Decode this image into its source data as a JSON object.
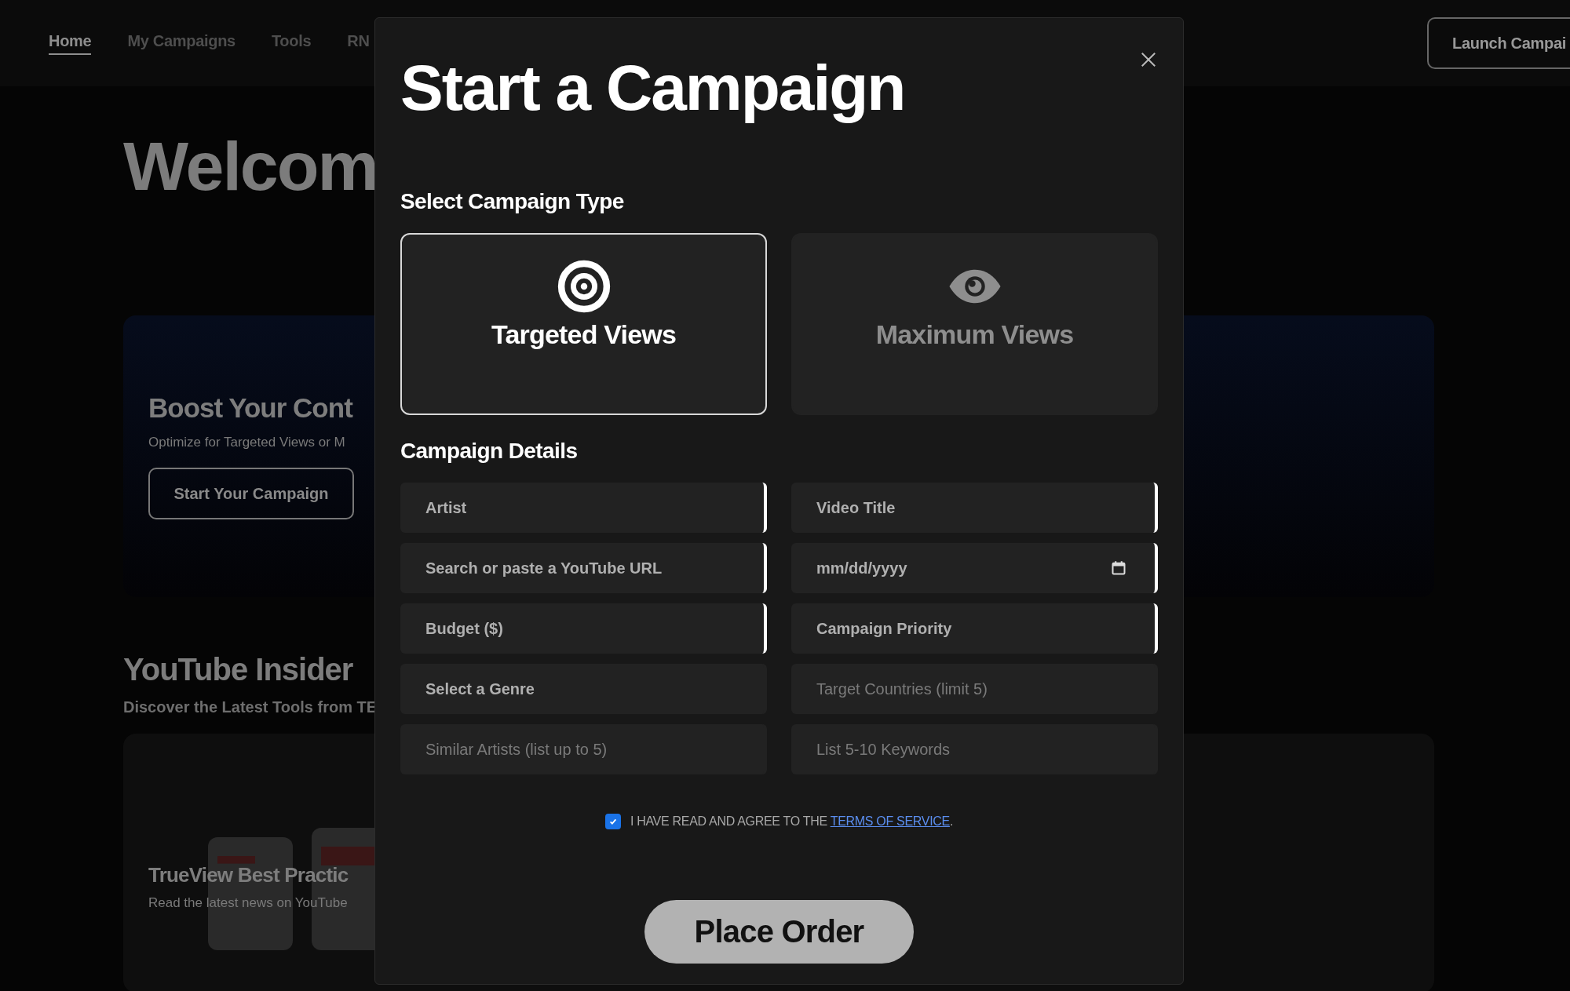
{
  "nav": {
    "tabs": [
      {
        "label": "Home",
        "selected": true
      },
      {
        "label": "My Campaigns",
        "selected": false
      },
      {
        "label": "Tools",
        "selected": false
      },
      {
        "label": "RN",
        "selected": false
      }
    ],
    "action_button": "Launch Campai"
  },
  "page": {
    "heading": "Welcom",
    "hero": {
      "title": "Boost Your Cont",
      "subtitle": "Optimize for Targeted Views or M",
      "button": "Start Your Campaign"
    },
    "insider": {
      "title": "YouTube Insider",
      "subtitle": "Discover the Latest Tools from TE",
      "card": {
        "title": "TrueView Best Practic",
        "text": "Read the latest news on YouTube"
      }
    }
  },
  "modal": {
    "title": "Start a Campaign",
    "type_heading": "Select Campaign Type",
    "campaign_types": [
      {
        "label": "Targeted Views",
        "kind": "target",
        "selected": true
      },
      {
        "label": "Maximum Views",
        "kind": "eye",
        "selected": false
      }
    ],
    "details_heading": "Campaign Details",
    "fields": [
      {
        "kind": "text",
        "placeholder": "Artist",
        "emphasis": true,
        "highlighted": true
      },
      {
        "kind": "text",
        "placeholder": "Video Title",
        "emphasis": true,
        "highlighted": true
      },
      {
        "kind": "text",
        "placeholder": "Search or paste a YouTube URL",
        "emphasis": true,
        "highlighted": true
      },
      {
        "kind": "date",
        "placeholder": "mm/dd/yyyy",
        "emphasis": true,
        "highlighted": true
      },
      {
        "kind": "text",
        "placeholder": "Budget ($)",
        "emphasis": true,
        "highlighted": true
      },
      {
        "kind": "text",
        "placeholder": "Campaign Priority",
        "emphasis": true,
        "highlighted": true
      },
      {
        "kind": "text",
        "placeholder": "Select a Genre",
        "emphasis": true,
        "highlighted": false
      },
      {
        "kind": "text",
        "placeholder": "Target Countries (limit 5)",
        "emphasis": false,
        "highlighted": false
      },
      {
        "kind": "text",
        "placeholder": "Similar Artists (list up to 5)",
        "emphasis": false,
        "highlighted": false
      },
      {
        "kind": "text",
        "placeholder": "List 5-10 Keywords",
        "emphasis": false,
        "highlighted": false
      }
    ],
    "agreement": {
      "checked": true,
      "text": "I HAVE READ AND AGREE TO THE ",
      "link": "TERMS OF SERVICE",
      "text_after": "."
    },
    "submit_button": "Place Order"
  }
}
